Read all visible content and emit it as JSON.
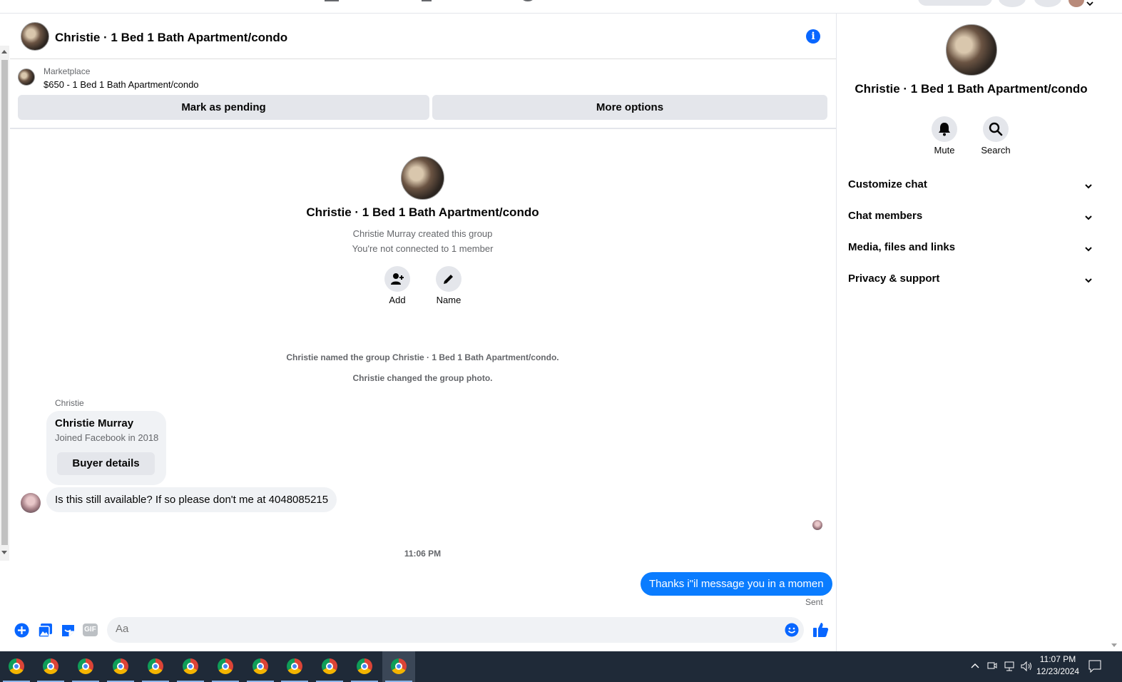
{
  "chat": {
    "title": "Christie · 1 Bed 1 Bath Apartment/condo",
    "marketplace_label": "Marketplace",
    "listing": "$650 - 1 Bed 1 Bath Apartment/condo",
    "mark_pending": "Mark as pending",
    "more_options": "More options"
  },
  "intro": {
    "group_name": "Christie · 1 Bed 1 Bath Apartment/condo",
    "created": "Christie Murray created this group",
    "connection": "You're not connected to 1 member",
    "add_label": "Add",
    "name_label": "Name"
  },
  "system_messages": {
    "named": "Christie named the group Christie · 1 Bed 1 Bath Apartment/condo.",
    "photo": "Christie changed the group photo."
  },
  "messages": {
    "sender": "Christie",
    "card_name": "Christie Murray",
    "card_joined": "Joined Facebook in 2018",
    "buyer_details": "Buyer details",
    "incoming": "Is this still available? If so please don't me at 4048085215",
    "timestamp": "11:06 PM",
    "outgoing": "Thanks i\"il message you in a momen",
    "sent": "Sent"
  },
  "composer": {
    "placeholder": "Aa"
  },
  "right_panel": {
    "title": "Christie · 1 Bed 1 Bath Apartment/condo",
    "mute": "Mute",
    "search": "Search",
    "sections": [
      "Customize chat",
      "Chat members",
      "Media, files and links",
      "Privacy & support"
    ]
  },
  "taskbar": {
    "time": "11:07 PM",
    "date": "12/23/2024"
  },
  "colors": {
    "accent": "#0866ff",
    "bubble_out": "#0a7cff",
    "bubble_in": "#f0f2f5",
    "taskbar": "#1f2a38"
  }
}
